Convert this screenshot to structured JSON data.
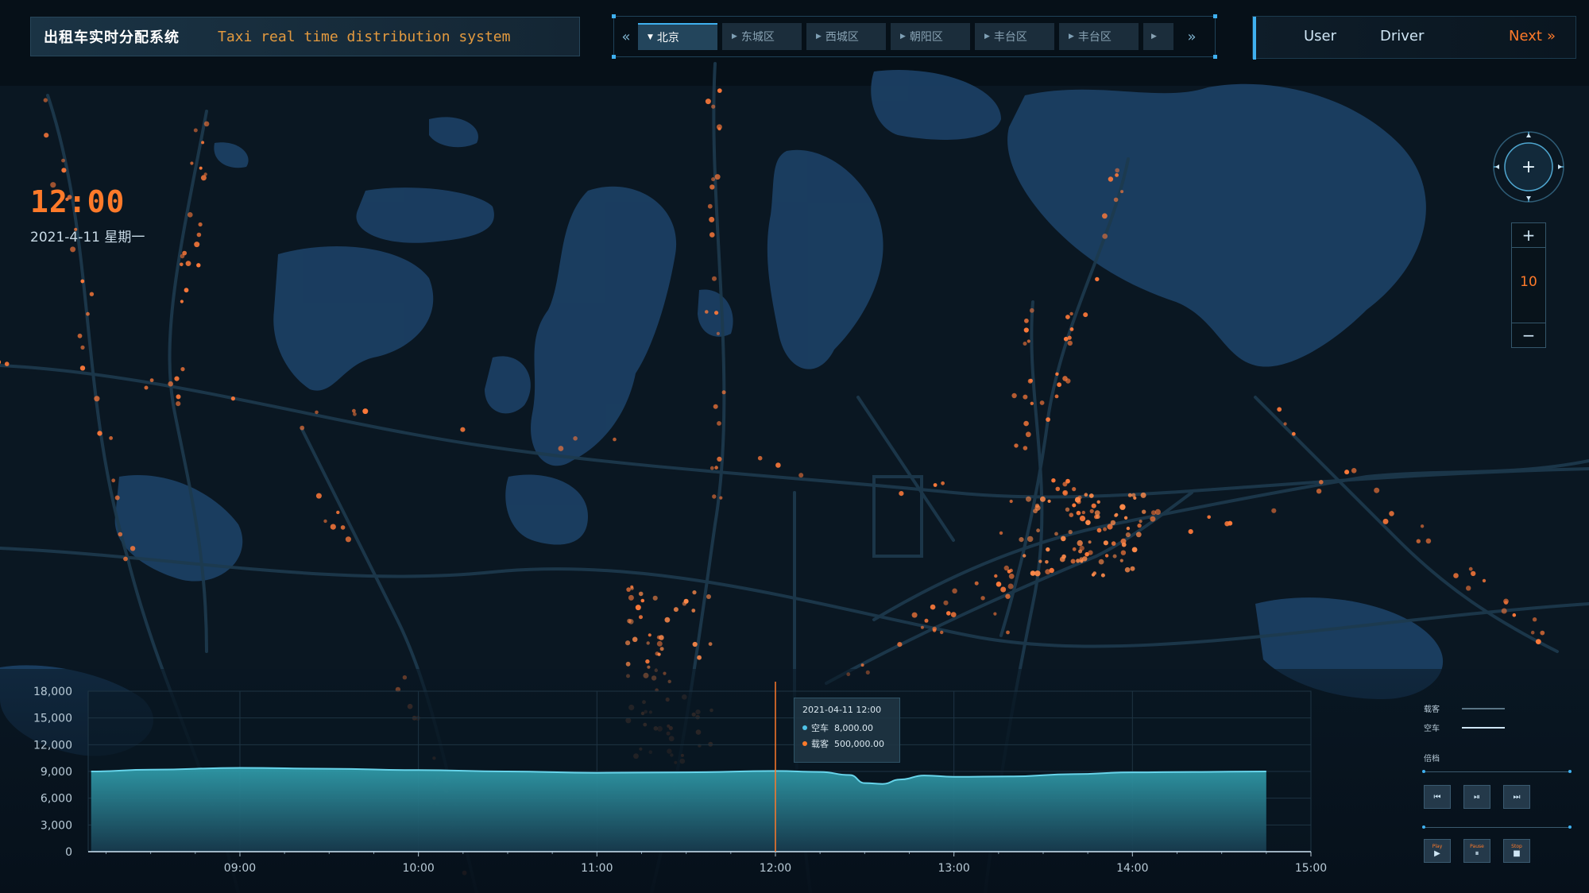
{
  "header": {
    "title": "出租车实时分配系统",
    "subtitle": "Taxi real time distribution system"
  },
  "tabs": {
    "items": [
      "北京",
      "东城区",
      "西城区",
      "朝阳区",
      "丰台区",
      "丰台区"
    ],
    "active_index": 0,
    "prev_icon": "«",
    "next_icon": "»",
    "caret_active": "▼",
    "caret": "▶"
  },
  "nav": {
    "user": "User",
    "driver": "Driver",
    "next": "Next",
    "next_icon": "»"
  },
  "clock": {
    "time": "12:00",
    "date": "2021-4-11 星期一"
  },
  "map_controls": {
    "zoom_in": "+",
    "zoom_out": "−",
    "zoom_level": "10",
    "compass_center": "+"
  },
  "colors": {
    "accent_orange": "#ff7a2a",
    "accent_blue": "#3fb0ef",
    "area_fill": "#2a8a9a",
    "area_line": "#67d4ea",
    "taxi_dot": "#ff7a3a"
  },
  "tooltip": {
    "time": "2021-04-11 12:00",
    "rows": [
      {
        "name": "空车",
        "value": "8,000.00",
        "color": "#4fc3e8"
      },
      {
        "name": "载客",
        "value": "500,000.00",
        "color": "#ff7a2a"
      }
    ]
  },
  "playback": {
    "legend": [
      {
        "name": "载客",
        "color": "#5a7585"
      },
      {
        "name": "空车",
        "color": "#cfe6f5"
      }
    ],
    "speed_label": "倍档",
    "prev_icon": "⏮",
    "step_icon": "⏯",
    "next_icon": "⏭",
    "play_label": "Play",
    "pause_label": "Pause",
    "stop_label": "Stop",
    "play_icon": "▶",
    "pause_icon": "⏸",
    "stop_icon": "■"
  },
  "chart_data": {
    "type": "area",
    "x_tick_labels": [
      "09:00",
      "10:00",
      "11:00",
      "12:00",
      "13:00",
      "14:00",
      "15:00"
    ],
    "y_tick_labels": [
      "0",
      "3,000",
      "6,000",
      "9,000",
      "12,000",
      "15,000",
      "18,000"
    ],
    "ylim": [
      0,
      18000
    ],
    "xlim_hours": [
      8.15,
      15.0
    ],
    "x": [
      "08:10",
      "08:30",
      "09:00",
      "09:30",
      "10:00",
      "10:30",
      "11:00",
      "11:30",
      "12:00",
      "12:15",
      "12:25",
      "12:30",
      "12:36",
      "12:42",
      "12:50",
      "13:00",
      "13:20",
      "13:40",
      "14:00",
      "14:20",
      "14:45"
    ],
    "series": [
      {
        "name": "空车",
        "values": [
          9000,
          9200,
          9400,
          9300,
          9150,
          9000,
          8850,
          8900,
          9050,
          8950,
          8600,
          7700,
          7600,
          8100,
          8550,
          8400,
          8450,
          8700,
          8900,
          8950,
          9000
        ]
      }
    ],
    "crosshair_x": "12:00",
    "grid": true
  }
}
